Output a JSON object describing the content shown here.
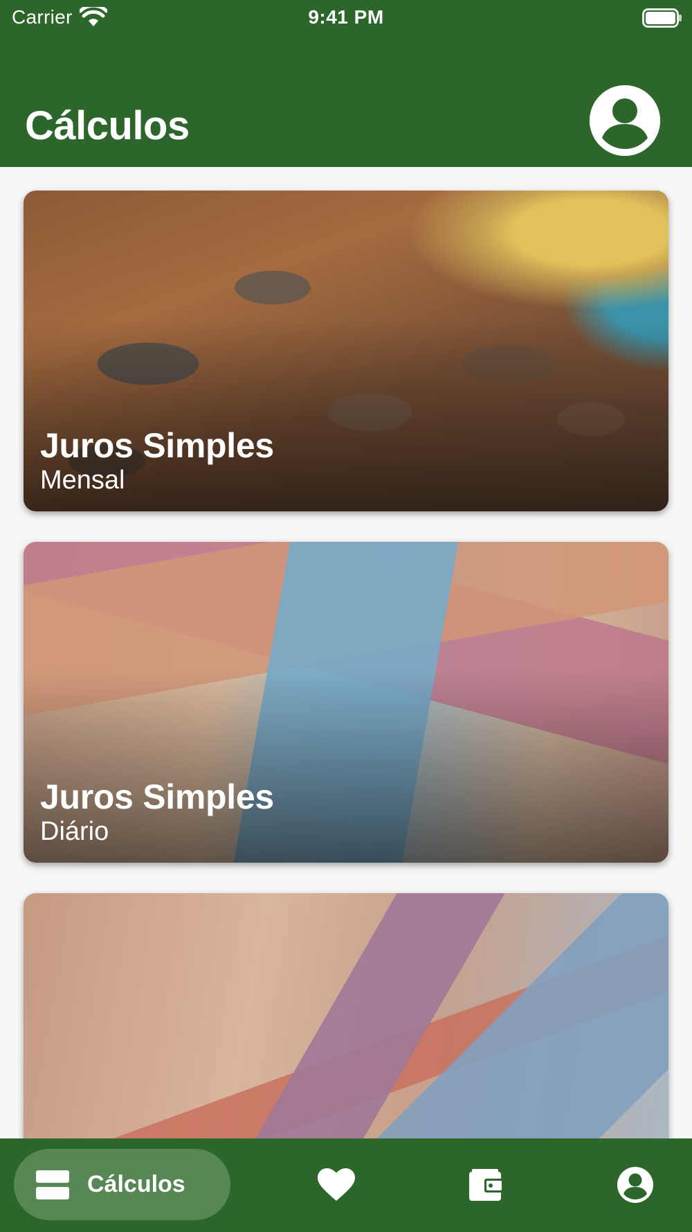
{
  "status_bar": {
    "carrier": "Carrier",
    "time": "9:41 PM",
    "icons": [
      "wifi-icon",
      "battery-icon"
    ]
  },
  "header": {
    "title": "Cálculos",
    "profile_icon": "account-circle-icon"
  },
  "cards": [
    {
      "title": "Juros Simples",
      "subtitle": "Mensal",
      "image": "coins-photo"
    },
    {
      "title": "Juros Simples",
      "subtitle": "Diário",
      "image": "banknotes-photo"
    },
    {
      "title": "",
      "subtitle": "",
      "image": "banknotes-fan-photo"
    }
  ],
  "bottom_nav": {
    "active_label": "Cálculos",
    "items": [
      {
        "icon": "calculations-grid-icon",
        "label": "Cálculos",
        "active": true
      },
      {
        "icon": "heart-icon",
        "active": false
      },
      {
        "icon": "wallet-icon",
        "active": false
      },
      {
        "icon": "account-circle-icon",
        "active": false
      }
    ]
  },
  "colors": {
    "brand_green": "#2d662b",
    "active_pill": "#568755",
    "background": "#f7f7f7",
    "on_brand": "#ffffff"
  }
}
